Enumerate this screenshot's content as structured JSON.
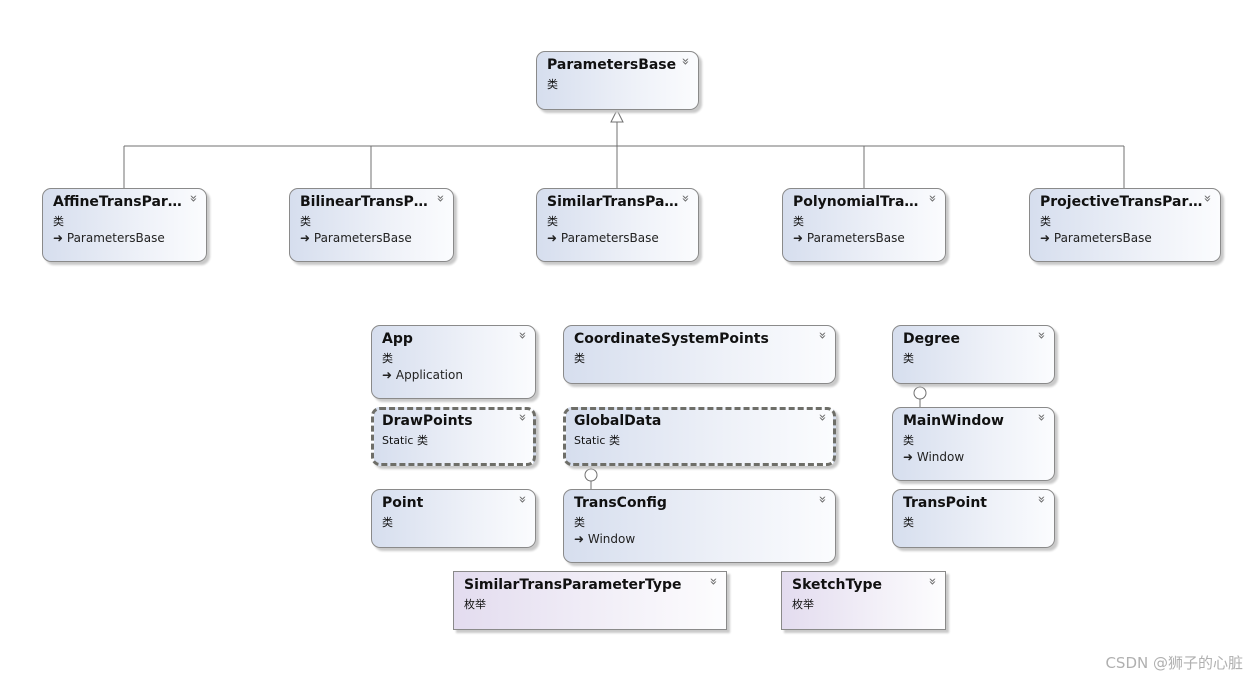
{
  "diagram": {
    "base_class": {
      "title": "ParametersBase",
      "kind": "类"
    },
    "derived_classes": [
      {
        "title": "AffineTransPar…",
        "kind": "类",
        "base": "ParametersBase"
      },
      {
        "title": "BilinearTransP…",
        "kind": "类",
        "base": "ParametersBase"
      },
      {
        "title": "SimilarTransPa…",
        "kind": "类",
        "base": "ParametersBase"
      },
      {
        "title": "PolynomialTra…",
        "kind": "类",
        "base": "ParametersBase"
      },
      {
        "title": "ProjectiveTransPar…",
        "kind": "类",
        "base": "ParametersBase"
      }
    ],
    "classes": [
      {
        "title": "App",
        "kind": "类",
        "base": "Application"
      },
      {
        "title": "CoordinateSystemPoints",
        "kind": "类"
      },
      {
        "title": "Degree",
        "kind": "类"
      },
      {
        "title": "DrawPoints",
        "kind": "Static 类"
      },
      {
        "title": "GlobalData",
        "kind": "Static 类"
      },
      {
        "title": "MainWindow",
        "kind": "类",
        "base": "Window"
      },
      {
        "title": "Point",
        "kind": "类"
      },
      {
        "title": "TransConfig",
        "kind": "类",
        "base": "Window"
      },
      {
        "title": "TransPoint",
        "kind": "类"
      }
    ],
    "enums": [
      {
        "title": "SimilarTransParameterType",
        "kind": "枚举"
      },
      {
        "title": "SketchType",
        "kind": "枚举"
      }
    ],
    "base_arrow_glyph": "➜",
    "expand_icon": "»"
  },
  "colors": {
    "class_fill": "#d6deee",
    "enum_fill": "#e3dcef",
    "border": "#8a8a8a",
    "line": "#707070"
  },
  "watermark": "CSDN @狮子的心脏"
}
